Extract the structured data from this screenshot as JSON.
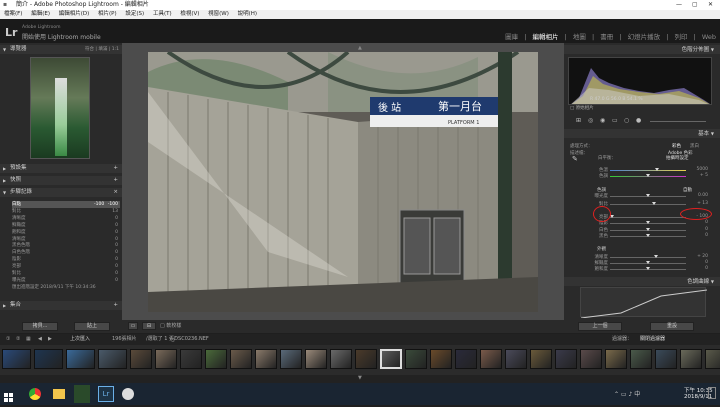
{
  "window": {
    "title": "簡介 - Adobe Photoshop Lightroom - 編輯相片"
  },
  "menu": [
    "檔案(F)",
    "編輯(E)",
    "編輯相片(D)",
    "相片(P)",
    "設定(S)",
    "工具(T)",
    "檢視(V)",
    "視窗(W)",
    "說明(H)"
  ],
  "identity": {
    "logo": "Lr",
    "adobe_line": "Adobe Lightroom",
    "mobile_line": "開始使用 Lightroom mobile"
  },
  "modules": {
    "library": "圖庫",
    "develop": "編輯相片",
    "map": "地圖",
    "book": "書冊",
    "slideshow": "幻燈片播放",
    "print": "列印",
    "web": "Web",
    "separator": "|"
  },
  "left": {
    "navigator": "導覽器",
    "nav_opts": "符合 | 填滿 | 1:1",
    "presets": "預設集",
    "snapshots": "快照",
    "history": "步驟記錄",
    "history_clear": "×",
    "collections": "集合",
    "history_items": [
      {
        "name": "白點",
        "a": "-100",
        "b": "-100"
      },
      {
        "name": "對比",
        "a": "",
        "b": "13"
      },
      {
        "name": "清晰度",
        "a": "",
        "b": "0"
      },
      {
        "name": "鮮豔度",
        "a": "",
        "b": "0"
      },
      {
        "name": "飽和度",
        "a": "",
        "b": "0"
      },
      {
        "name": "清晰度",
        "a": "",
        "b": "0"
      },
      {
        "name": "黑色色階",
        "a": "",
        "b": "0"
      },
      {
        "name": "白色色階",
        "a": "",
        "b": "0"
      },
      {
        "name": "陰影",
        "a": "",
        "b": "0"
      },
      {
        "name": "亮部",
        "a": "",
        "b": "0"
      },
      {
        "name": "對比",
        "a": "",
        "b": "0"
      },
      {
        "name": "曝光度",
        "a": "",
        "b": "0"
      },
      {
        "name": "匯出進階設定 2018/9/11 下午 10:34:36",
        "a": "",
        "b": ""
      }
    ]
  },
  "left_buttons": {
    "copy": "拷貝...",
    "paste": "貼上"
  },
  "right": {
    "histogram": "色階分佈圖",
    "hist_values": "R 47.0  G 56.0  B 54.1 %",
    "original": "原始相片",
    "basic": "基本",
    "treatment": "處理方式：",
    "color": "彩色",
    "bw": "黑白",
    "profile": "描述檔：",
    "profile_val": "Adobe 色彩",
    "wb": "白平衡：",
    "wb_val": "拍攝時設定",
    "tone": "色調",
    "auto": "自動",
    "presence": "外觀",
    "tone_curve": "色調曲線",
    "sliders": [
      {
        "label": "色溫",
        "value": "5000"
      },
      {
        "label": "色調",
        "value": "+ 5"
      },
      {
        "label": "曝光度",
        "value": "0.00"
      },
      {
        "label": "對比",
        "value": "+ 13"
      },
      {
        "label": "亮部",
        "value": "- 100"
      },
      {
        "label": "陰影",
        "value": "0"
      },
      {
        "label": "白色",
        "value": "0"
      },
      {
        "label": "黑色",
        "value": "0"
      },
      {
        "label": "清晰度",
        "value": "+ 20"
      },
      {
        "label": "鮮豔度",
        "value": "0"
      },
      {
        "label": "飽和度",
        "value": "0"
      }
    ]
  },
  "right_buttons": {
    "prev": "上一個",
    "reset": "重設"
  },
  "toolbar": {
    "soft_proof": "軟校樣"
  },
  "filmstrip": {
    "prev_import": "上次匯入",
    "count": "196張相片",
    "selected": "/選取了 1 張/",
    "filename": "/_DSC0236.NEF",
    "filter_label": "過濾器：",
    "filter_val": "關閉過濾器"
  },
  "photo_signs": {
    "station": "後 站",
    "platform": "第一月台",
    "platform_en": "PLATFORM 1"
  },
  "taskbar": {
    "time": "下午 10:35",
    "date": "2018/9/11"
  },
  "colors": {
    "accent": "#e02020",
    "panel": "#2a2a2a",
    "bg": "#4c4c4c"
  }
}
